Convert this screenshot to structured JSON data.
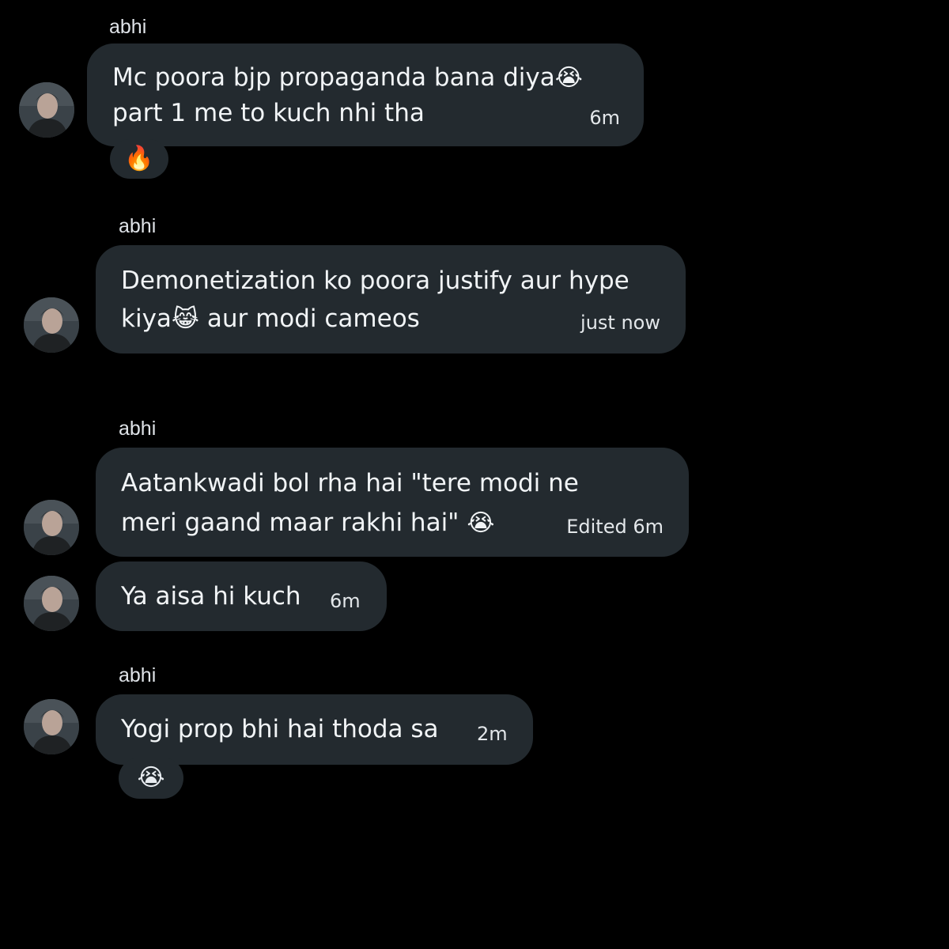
{
  "messages": [
    {
      "sender": "abhi",
      "text_line1": "Mc poora bjp propaganda bana diya",
      "emoji1": "😭",
      "text_line2": "part 1 me to kuch nhi tha",
      "time": "6m",
      "reaction": "🔥"
    },
    {
      "sender": "abhi",
      "text_line1": "Demonetization ko poora justify aur hype",
      "text_line2a": "kiya",
      "emoji2": "😹",
      "text_line2b": " aur modi cameos",
      "time": "just now"
    },
    {
      "sender": "abhi",
      "text_line1": "Aatankwadi bol rha hai \"tere modi ne",
      "text_line2": "meri gaand maar rakhi hai\" ",
      "emoji2": "😭",
      "time": "Edited 6m"
    },
    {
      "text": "Ya aisa hi kuch",
      "time": "6m"
    },
    {
      "sender": "abhi",
      "text": "Yogi prop bhi hai thoda sa",
      "time": "2m",
      "reaction": "😭"
    }
  ],
  "colors": {
    "background": "#000000",
    "bubble": "#232a2f",
    "text": "#f1f4f6"
  },
  "icons": [
    "avatar-portrait",
    "fire-emoji",
    "loudly-crying-emoji",
    "cat-tears-of-joy-emoji"
  ]
}
